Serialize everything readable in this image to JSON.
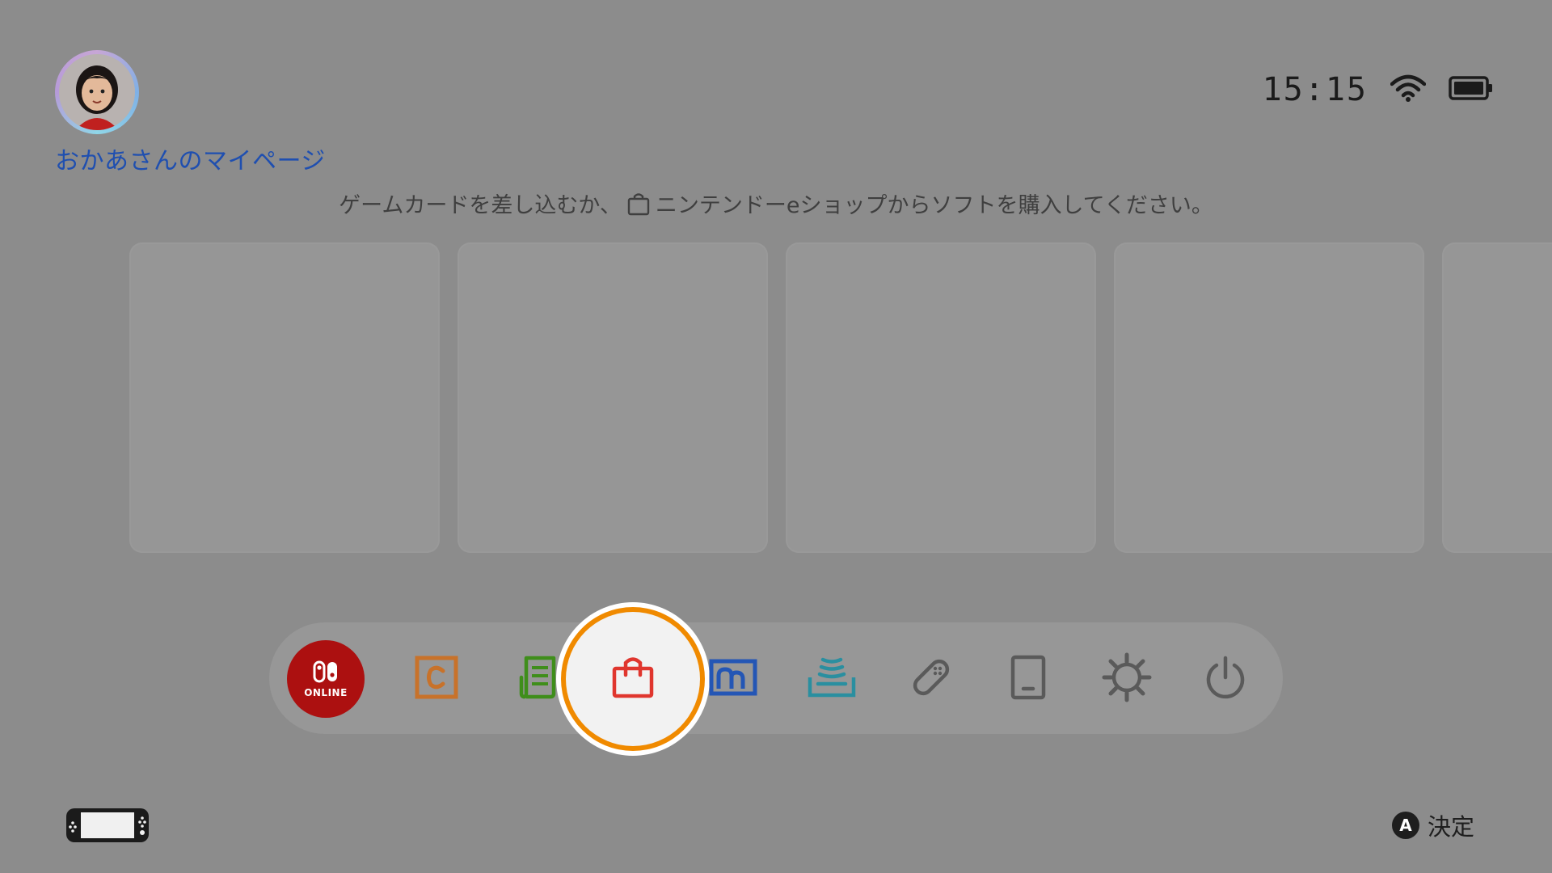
{
  "header": {
    "user_page_label": "おかあさんのマイページ",
    "avatar_icon": "mii-avatar-icon"
  },
  "status": {
    "time": "15:15",
    "wifi_icon": "wifi-icon",
    "battery_icon": "battery-icon"
  },
  "hint": {
    "before_icon": "ゲームカードを差し込むか、",
    "icon": "eshop-bag-icon",
    "after_icon": "ニンテンドーeショップからソフトを購入してください。"
  },
  "software_tiles": [
    {},
    {},
    {},
    {},
    {}
  ],
  "dock": {
    "items": [
      {
        "icon": "nintendo-switch-online-icon",
        "label": "ONLINE"
      },
      {
        "icon": "album-c-icon"
      },
      {
        "icon": "news-icon"
      },
      {
        "icon": "eshop-bag-icon",
        "selected": true
      },
      {
        "icon": "album-icon"
      },
      {
        "icon": "vs-wireless-icon"
      },
      {
        "icon": "controller-icon"
      },
      {
        "icon": "tablet-icon"
      },
      {
        "icon": "settings-gear-icon"
      },
      {
        "icon": "power-icon"
      }
    ]
  },
  "footer": {
    "console_icon": "switch-console-icon",
    "confirm_button": "A",
    "confirm_label": "決定"
  },
  "colors": {
    "background": "#8c8c8c",
    "link": "#1f4fb0",
    "selection_ring": "#f08a00",
    "online_red": "#ac1010",
    "eshop_red": "#e0362e",
    "album_orange": "#c8722a",
    "news_green": "#3f8e1b",
    "album_blue": "#2456b5",
    "wireless_teal": "#2a8fa0",
    "system_gray": "#5a5a5a"
  }
}
